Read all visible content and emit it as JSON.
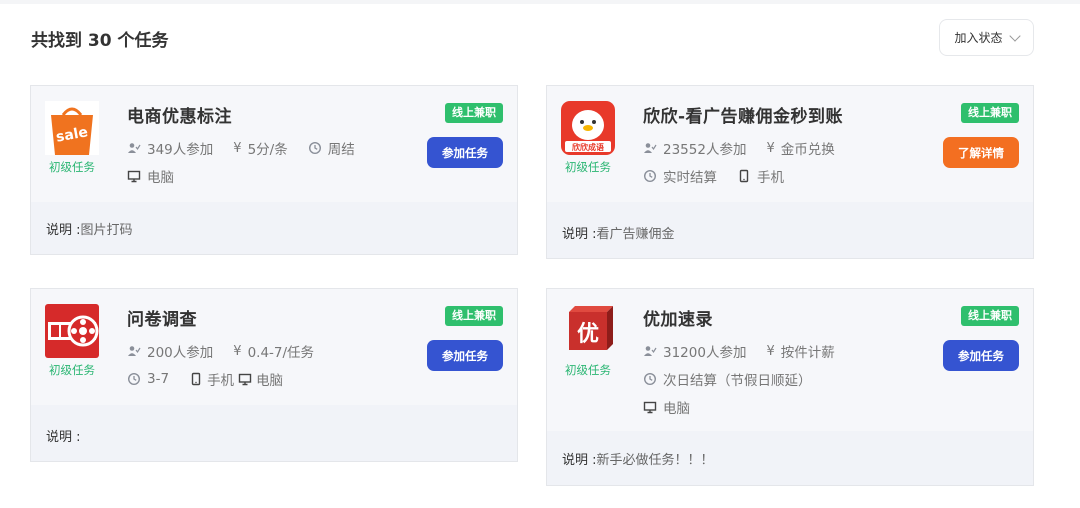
{
  "header": {
    "title": "共找到 30 个任务",
    "state_label": "加入状态"
  },
  "cards": [
    {
      "title": "电商优惠标注",
      "level": "初级任务",
      "badge": "线上兼职",
      "participants": "349人参加",
      "price": "5分/条",
      "settlement": "周结",
      "device": "电脑",
      "action": "参加任务",
      "desc_label": "说明 :",
      "desc": "图片打码",
      "thumb_text": "sale",
      "thumb_color": "#f0731f"
    },
    {
      "title": "欣欣-看广告赚佣金秒到账",
      "level": "初级任务",
      "badge": "线上兼职",
      "participants": "23552人参加",
      "price": "金币兑换",
      "settlement": "实时结算",
      "device": "手机",
      "action": "了解详情",
      "desc_label": "说明 :",
      "desc": "看广告赚佣金",
      "thumb_text": "欣欣成语",
      "thumb_color": "#e8392a"
    },
    {
      "title": "问卷调查",
      "level": "初级任务",
      "badge": "线上兼职",
      "participants": "200人参加",
      "price": "0.4-7/任务",
      "settlement": "3-7",
      "device": "手机",
      "device2": "电脑",
      "action": "参加任务",
      "desc_label": "说明 :",
      "desc": "",
      "thumb_color": "#d62a2a"
    },
    {
      "title": "优加速录",
      "level": "初级任务",
      "badge": "线上兼职",
      "participants": "31200人参加",
      "price": "按件计薪",
      "settlement": "次日结算（节假日顺延）",
      "device": "电脑",
      "action": "参加任务",
      "desc_label": "说明 :",
      "desc": "新手必做任务！！！",
      "thumb_text": "优",
      "thumb_color": "#c9302c"
    }
  ],
  "colors": {
    "badge_green": "#2fbf6d",
    "button_blue": "#3554d1",
    "button_orange": "#f36f21",
    "level_green": "#2bb673"
  }
}
